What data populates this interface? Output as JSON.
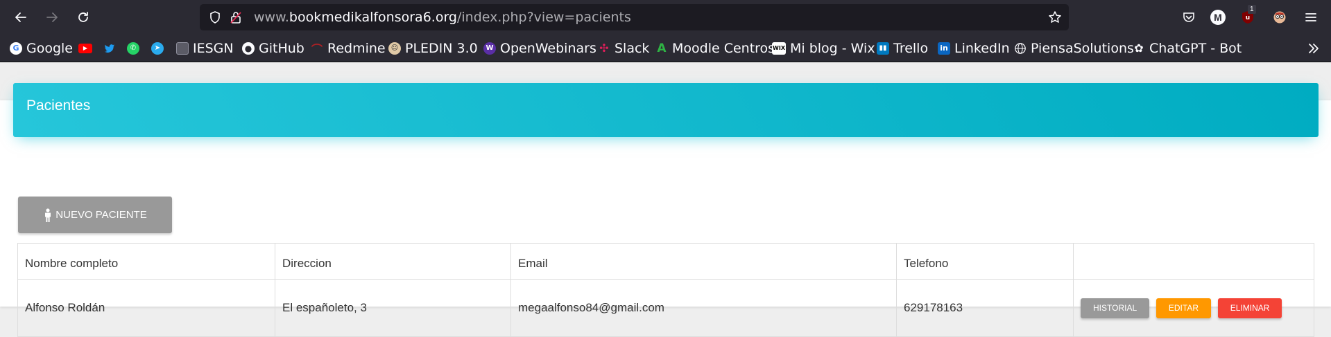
{
  "browser": {
    "url_prefix": "www.",
    "url_domain": "bookmedikalfonsora6.org",
    "url_path": "/index.php?view=pacients",
    "profile_initial": "M",
    "extension_badge": "1"
  },
  "bookmarks": [
    {
      "label": "Google",
      "icon": "google-icon",
      "color": "#ffffff"
    },
    {
      "label": "",
      "icon": "youtube-icon",
      "color": "#ff0000"
    },
    {
      "label": "",
      "icon": "twitter-icon",
      "color": "#1d9bf0"
    },
    {
      "label": "",
      "icon": "whatsapp-icon",
      "color": "#25d366"
    },
    {
      "label": "",
      "icon": "telegram-icon",
      "color": "#2aabee"
    },
    {
      "label": "IESGN",
      "icon": "page-icon",
      "color": "#8f8f9d"
    },
    {
      "label": "GitHub",
      "icon": "github-icon",
      "color": "#fbfbfe"
    },
    {
      "label": "Redmine",
      "icon": "redmine-icon",
      "color": "#b32024"
    },
    {
      "label": "PLEDIN 3.0",
      "icon": "pledin-icon",
      "color": "#e0c9a6"
    },
    {
      "label": "OpenWebinars",
      "icon": "openwebinars-icon",
      "color": "#5a2ea6"
    },
    {
      "label": "Slack",
      "icon": "slack-icon",
      "color": "#e01e5a"
    },
    {
      "label": "Moodle Centros",
      "icon": "moodle-icon",
      "color": "#2fb344"
    },
    {
      "label": "Mi blog - Wix",
      "icon": "wix-icon",
      "color": "#ffffff"
    },
    {
      "label": "Trello",
      "icon": "trello-icon",
      "color": "#0079bf"
    },
    {
      "label": "LinkedIn",
      "icon": "linkedin-icon",
      "color": "#0a66c2"
    },
    {
      "label": "PiensaSolutions",
      "icon": "globe-icon",
      "color": "#fbfbfe"
    },
    {
      "label": "ChatGPT - Bot",
      "icon": "chatgpt-icon",
      "color": "#fbfbfe"
    }
  ],
  "page": {
    "title": "Pacientes",
    "new_button": "NUEVO PACIENTE",
    "accent": "#00bcd4"
  },
  "table": {
    "headers": [
      "Nombre completo",
      "Direccion",
      "Email",
      "Telefono",
      ""
    ],
    "rows": [
      {
        "name": "Alfonso Roldán",
        "address": "El españoleto, 3",
        "email": "megaalfonso84@gmail.com",
        "phone": "629178163",
        "actions": [
          {
            "label": "HISTORIAL",
            "color": "#999999"
          },
          {
            "label": "EDITAR",
            "color": "#ff9800"
          },
          {
            "label": "ELIMINAR",
            "color": "#f44336"
          }
        ]
      }
    ]
  }
}
